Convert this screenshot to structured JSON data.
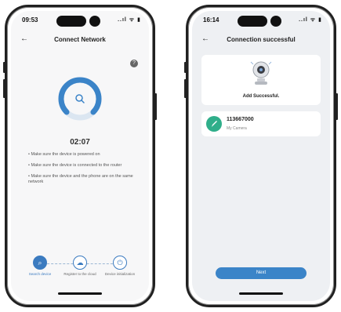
{
  "left_phone": {
    "status": {
      "time": "09:53",
      "signal": "..ıl ᯤ ▮"
    },
    "nav": {
      "back": "←",
      "title": "Connect Network"
    },
    "help": "?",
    "gauge_progress": 0.75,
    "timer": "02:07",
    "tips": [
      "• Make sure the device is powered on",
      "• Make sure the device is connected to the router",
      "• Make sure the device and the phone are on the same network"
    ],
    "steps": [
      {
        "icon": "search-icon",
        "label": "Search device",
        "active": true
      },
      {
        "icon": "cloud-icon",
        "label": "Register to the cloud",
        "active": false
      },
      {
        "icon": "power-icon",
        "label": "Device initialization",
        "active": false
      }
    ]
  },
  "right_phone": {
    "status": {
      "time": "16:14",
      "signal": "..ıl ᯤ ▮"
    },
    "nav": {
      "back": "←",
      "title": "Connection successful"
    },
    "success_text": "Add Successful.",
    "device": {
      "id": "113667000",
      "subtitle": "My Camera"
    },
    "next_label": "Next"
  },
  "colors": {
    "accent": "#3b84c8",
    "device_green": "#2fae8a"
  }
}
